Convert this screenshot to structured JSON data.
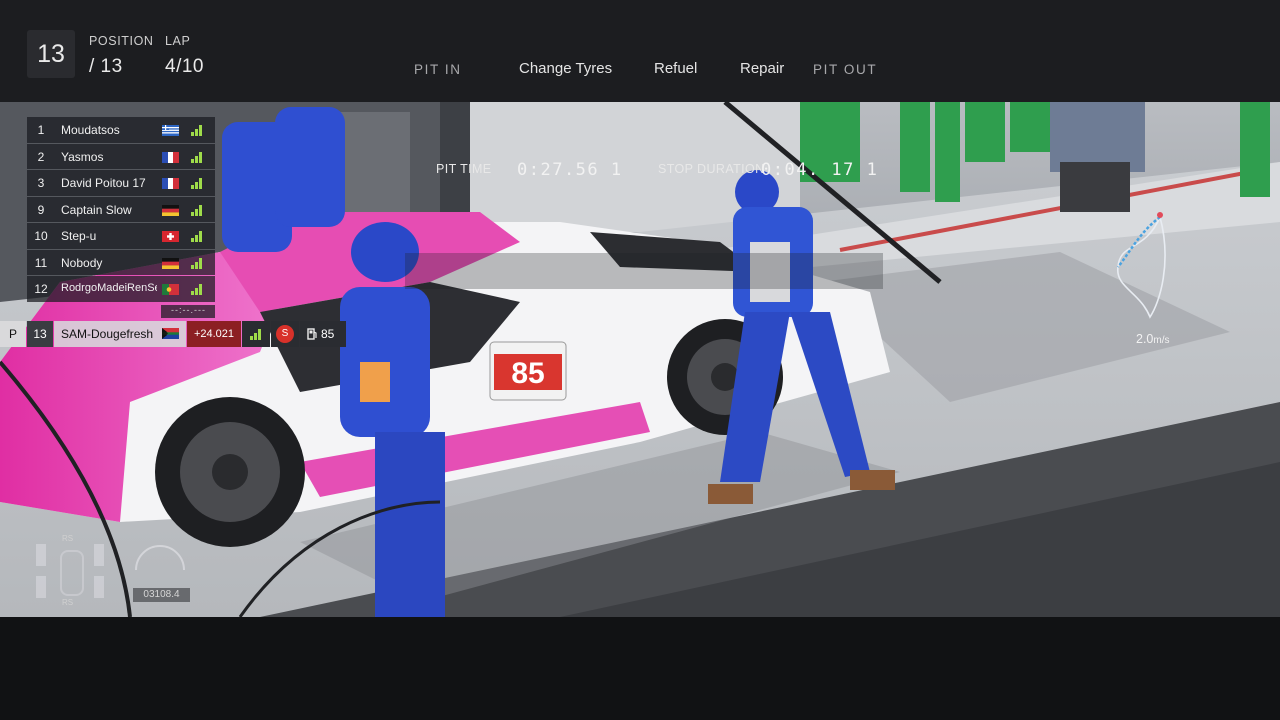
{
  "hud": {
    "position_label": "POSITION",
    "position": "13",
    "position_total": "/ 13",
    "lap_label": "LAP",
    "lap": "4/10"
  },
  "pit_menu": {
    "items": [
      "PIT IN",
      "Change Tyres",
      "Refuel",
      "Repair",
      "PIT OUT"
    ]
  },
  "pit_timing": {
    "pit_time_label": "PIT TIME",
    "pit_time": "0:27.56 1",
    "stop_duration_label": "STOP DURATION",
    "stop_duration": "0:04. 17 1"
  },
  "leaderboard": {
    "rows": [
      {
        "pos": "1",
        "name": "Moudatsos",
        "flag": "greece"
      },
      {
        "pos": "2",
        "name": "Yasmos",
        "flag": "france"
      },
      {
        "pos": "3",
        "name": "David Poitou 17",
        "flag": "france"
      },
      {
        "pos": "9",
        "name": "Captain Slow",
        "flag": "germany"
      },
      {
        "pos": "10",
        "name": "Step-u",
        "flag": "switzerland"
      },
      {
        "pos": "11",
        "name": "Nobody",
        "flag": "germany"
      },
      {
        "pos": "12",
        "name": "RodrgoMadeiRenSe",
        "flag": "portugal"
      }
    ],
    "gap_placeholder": "--:--.---",
    "player": {
      "status": "P",
      "pos": "13",
      "name": "SAM-Dougefresh",
      "flag": "south-africa",
      "gap": "+24.021",
      "tyre": "S",
      "fuel": "85"
    }
  },
  "telemetry": {
    "speed": "2.0",
    "speed_unit": "m/s",
    "odometer": "03108.4",
    "tyre_labels": [
      "RS",
      "RS"
    ]
  },
  "colors": {
    "signal_green": "#9fdc4a",
    "gap_red": "#8c1f23",
    "tyre_soft": "#d8312a",
    "car_pink": "#e23ba8",
    "crew_blue": "#2743c9"
  }
}
